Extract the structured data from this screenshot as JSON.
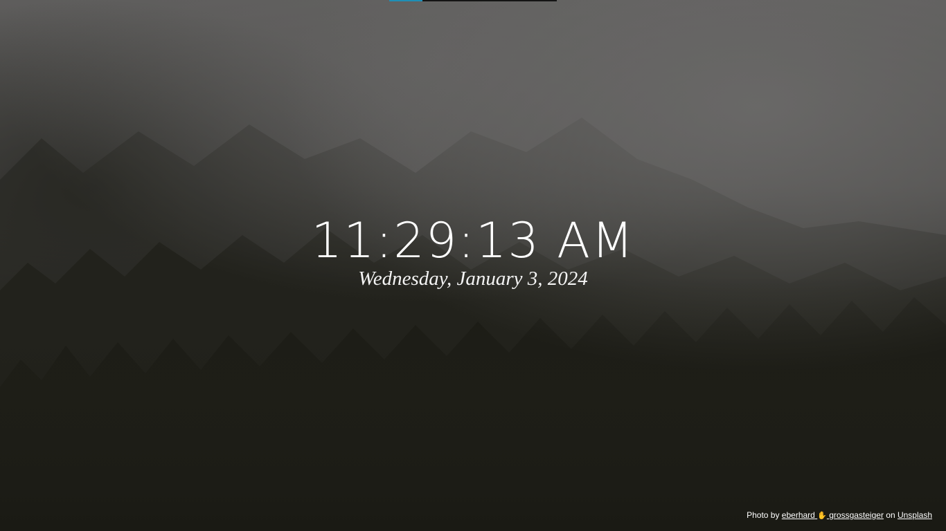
{
  "progress": {
    "fraction": 0.2,
    "track_color": "#141414",
    "fill_color": "#1e8fb6"
  },
  "clock": {
    "time": "11:29:13 AM",
    "date": "Wednesday, January 3, 2024"
  },
  "credit": {
    "prefix": "Photo by ",
    "author_first": "eberhard",
    "author_icon": "raised-hand-icon",
    "author_last": "grossgasteiger",
    "middle": " on ",
    "source": "Unsplash"
  },
  "colors": {
    "text": "#ffffff",
    "fog": "#5f5e5d",
    "forest": "#1f1f19"
  }
}
